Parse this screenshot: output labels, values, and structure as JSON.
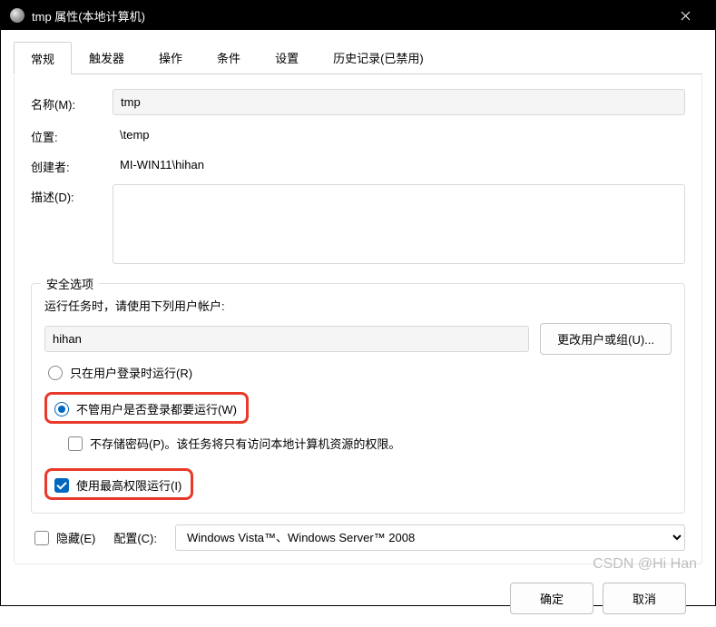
{
  "window": {
    "title": "tmp 属性(本地计算机)"
  },
  "tabs": {
    "general": "常规",
    "triggers": "触发器",
    "actions": "操作",
    "conditions": "条件",
    "settings": "设置",
    "history": "历史记录(已禁用)"
  },
  "labels": {
    "name": "名称(M):",
    "location": "位置:",
    "author": "创建者:",
    "description": "描述(D):"
  },
  "fields": {
    "name": "tmp",
    "location": "\\temp",
    "author": "MI-WIN11\\hihan",
    "description": ""
  },
  "security": {
    "group_title": "安全选项",
    "run_as_label": "运行任务时，请使用下列用户帐户:",
    "account": "hihan",
    "change_user_btn": "更改用户或组(U)...",
    "radio_logged_on": "只在用户登录时运行(R)",
    "radio_always": "不管用户是否登录都要运行(W)",
    "cb_no_store_pw": "不存储密码(P)。该任务将只有访问本地计算机资源的权限。",
    "cb_highest": "使用最高权限运行(I)"
  },
  "bottom": {
    "hidden": "隐藏(E)",
    "config_label": "配置(C):",
    "config_value": "Windows Vista™、Windows Server™ 2008"
  },
  "buttons": {
    "ok": "确定",
    "cancel": "取消"
  },
  "watermark": "CSDN @Hi Han"
}
